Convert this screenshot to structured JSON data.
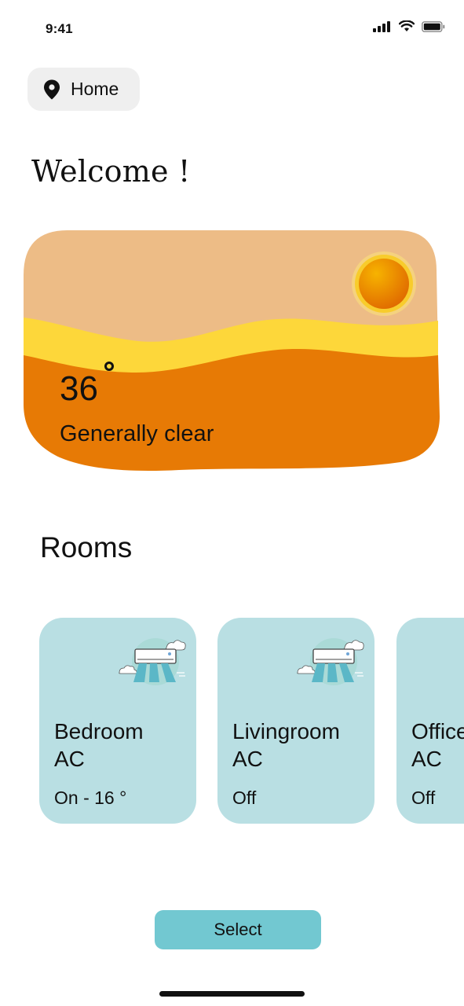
{
  "status_bar": {
    "time": "9:41",
    "icons": [
      "cellular-signal-icon",
      "wifi-icon",
      "battery-icon"
    ]
  },
  "location": {
    "icon": "location-pin-icon",
    "label": "Home"
  },
  "welcome": "Welcome !",
  "weather": {
    "temperature": "36",
    "condition": "Generally clear",
    "icon": "sun-icon",
    "colors": {
      "sky": "#edbc86",
      "band": "#fdd73a",
      "ground": "#e77a05",
      "sun": "#f0a500"
    }
  },
  "rooms": {
    "title": "Rooms",
    "card_color": "#b9dfe3",
    "items": [
      {
        "name": "Bedroom\nAC",
        "status": "On - 16 °",
        "icon": "air-conditioner-icon"
      },
      {
        "name": "Livingroom\nAC",
        "status": "Off",
        "icon": "air-conditioner-icon"
      },
      {
        "name": "Office\nAC",
        "status": "Off",
        "icon": "air-conditioner-icon"
      }
    ]
  },
  "actions": {
    "select_label": "Select",
    "select_color": "#72c8d1"
  }
}
